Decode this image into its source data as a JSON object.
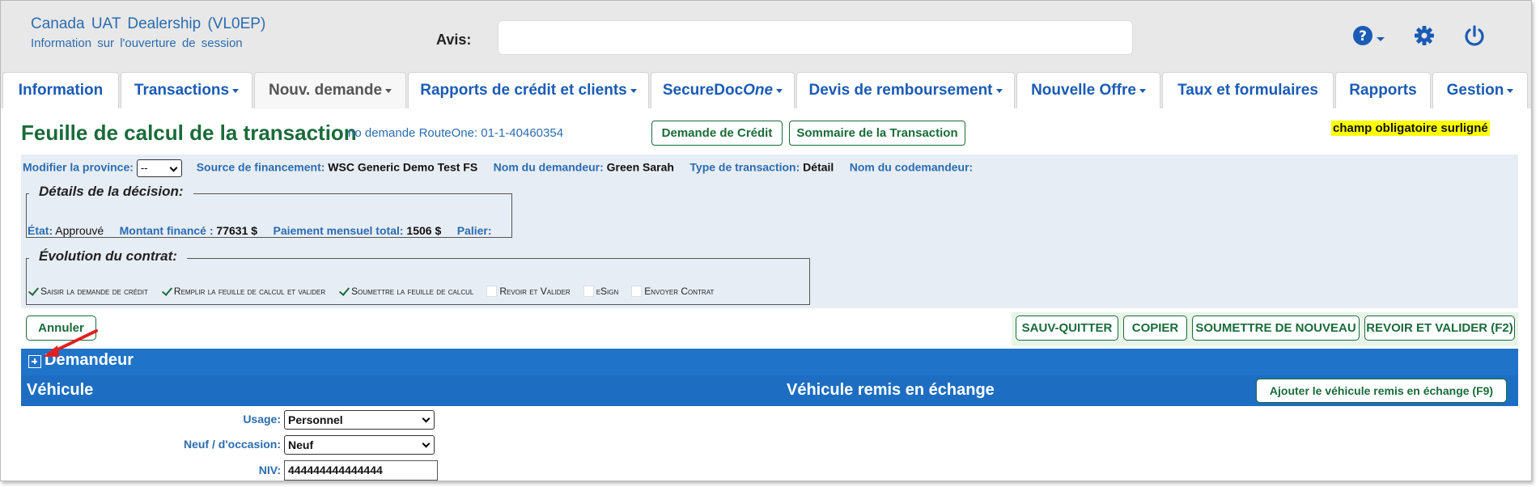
{
  "header": {
    "dealer_title": "Canada UAT Dealership (VL0EP)",
    "session_info": "Information sur l'ouverture de session",
    "notice_label": "Avis:",
    "notice_value": ""
  },
  "icons": {
    "help": "help-icon",
    "settings": "gear-icon",
    "logout": "power-icon"
  },
  "nav": {
    "tabs": [
      {
        "label": "Information"
      },
      {
        "label": "Transactions"
      },
      {
        "label": "Nouv. demande"
      },
      {
        "label": "Rapports de crédit et clients"
      },
      {
        "label_a": "SecureDoc",
        "label_b": "One"
      },
      {
        "label": "Devis de remboursement"
      },
      {
        "label": "Nouvelle Offre"
      },
      {
        "label": "Taux et formulaires"
      },
      {
        "label": "Rapports"
      },
      {
        "label": "Gestion"
      }
    ]
  },
  "page": {
    "title": "Feuille de calcul de la transaction",
    "request_no": "no demande RouteOne: 01-1-40460354",
    "credit_request_button": "Demande de Crédit",
    "summary_button": "Sommaire de la Transaction",
    "required_note": "champ obligatoire surligné"
  },
  "info": {
    "province_label": "Modifier la province:",
    "province_value": "--",
    "funding_label": "Source de financement:",
    "funding_value": "WSC Generic Demo Test FS",
    "applicant_label": "Nom du demandeur:",
    "applicant_value": "Green Sarah",
    "type_label": "Type de transaction:",
    "type_value": "Détail",
    "coapplicant_label": "Nom du codemandeur:",
    "coapplicant_value": ""
  },
  "decision": {
    "legend": "Détails de la décision:",
    "state_label": "État:",
    "state_value": "Approuvé",
    "amount_label": "Montant financé :",
    "amount_value": "77631 $",
    "payment_label": "Paiement mensuel total:",
    "payment_value": "1506 $",
    "tier_label": "Palier:",
    "tier_value": ""
  },
  "progress": {
    "legend": "Évolution du contrat:",
    "steps": [
      {
        "label": "Saisir la demande de crédit",
        "done": true
      },
      {
        "label": "Remplir la feuille de calcul et valider",
        "done": true
      },
      {
        "label": "Soumettre la feuille de calcul",
        "done": true
      },
      {
        "label": "Revoir et Valider",
        "done": false
      },
      {
        "label": "eSign",
        "done": false
      },
      {
        "label": "Envoyer Contrat",
        "done": false
      }
    ]
  },
  "actions": {
    "cancel": "Annuler",
    "save_quit": "SAUV-QUITTER",
    "copy": "COPIER",
    "resubmit": "SOUMETTRE DE NOUVEAU",
    "review": "REVOIR ET VALIDER (F2)"
  },
  "sections": {
    "applicant": "Demandeur",
    "vehicle": "Véhicule",
    "trade_in": "Véhicule remis en échange",
    "add_trade_in": "Ajouter le véhicule remis en échange (F9)"
  },
  "vehicle_form": {
    "usage_label": "Usage:",
    "usage_value": "Personnel",
    "condition_label": "Neuf / d'occasion:",
    "condition_value": "Neuf",
    "vin_label": "NIV:",
    "vin_value": "444444444444444"
  },
  "colors": {
    "brand_green": "#1a6b3a",
    "link_blue": "#2b6cb0",
    "bar_blue": "#1f73c9",
    "highlight": "#ffff00"
  }
}
